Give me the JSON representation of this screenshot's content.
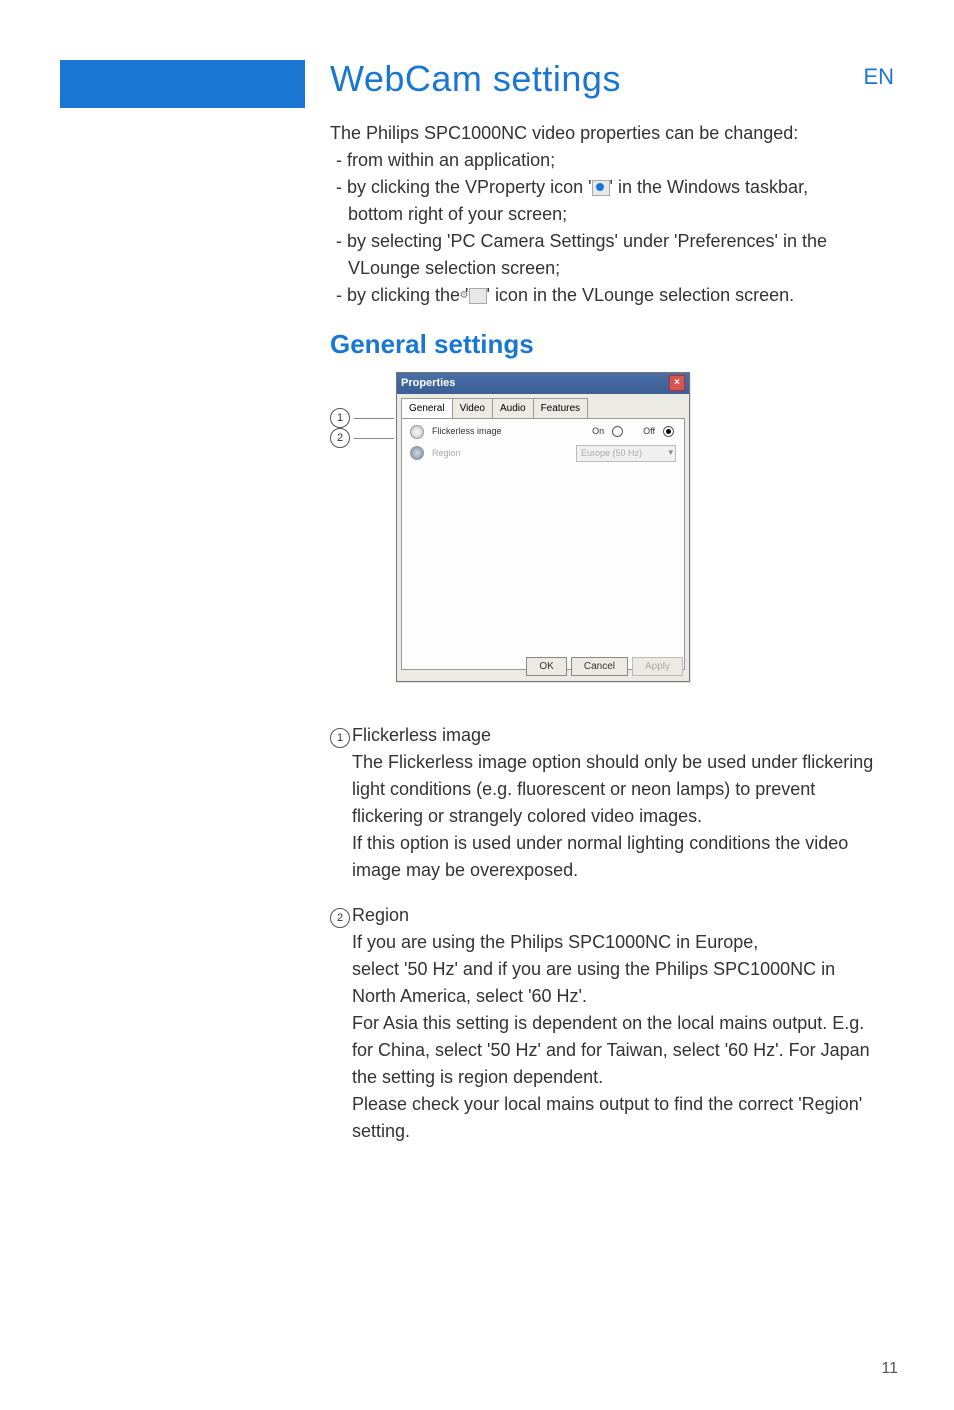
{
  "header": {
    "title": "WebCam settings",
    "lang": "EN"
  },
  "intro": {
    "line1": "The Philips SPC1000NC video properties can be changed:",
    "bullet1": "- from within an application;",
    "bullet2a": "- by clicking the VProperty icon '",
    "bullet2b": "' in the Windows taskbar,",
    "bullet2c": "bottom right of your screen;",
    "bullet3a": "- by selecting 'PC Camera Settings' under 'Preferences' in the",
    "bullet3b": "VLounge selection screen;",
    "bullet4a": "- by clicking the '",
    "bullet4b": "' icon in the VLounge selection screen."
  },
  "h2": "General settings",
  "dialog": {
    "title": "Properties",
    "tabs": [
      "General",
      "Video",
      "Audio",
      "Features"
    ],
    "flicker_label": "Flickerless image",
    "on": "On",
    "off": "Off",
    "region_label": "Region",
    "region_value": "Europe (50 Hz)",
    "ok": "OK",
    "cancel": "Cancel",
    "apply": "Apply"
  },
  "sections": {
    "s1": {
      "num": "1",
      "label": "Flickerless image",
      "p1": "The Flickerless image option should only be used under flickering light conditions (e.g. fluorescent or neon lamps) to prevent flickering or strangely colored video images.",
      "p2": "If this option is used under normal lighting conditions the video image may be overexposed."
    },
    "s2": {
      "num": "2",
      "label": "Region",
      "p1": "If you are using the Philips SPC1000NC in Europe,",
      "p2": "select '50 Hz' and if you are using the Philips SPC1000NC in North America, select '60 Hz'.",
      "p3": "For Asia this setting is dependent on the local mains output. E.g. for China, select '50 Hz' and for Taiwan, select '60 Hz'. For Japan the setting is region dependent.",
      "p4": "Please check your local mains output to find the correct 'Region' setting."
    }
  },
  "page_number": "11"
}
